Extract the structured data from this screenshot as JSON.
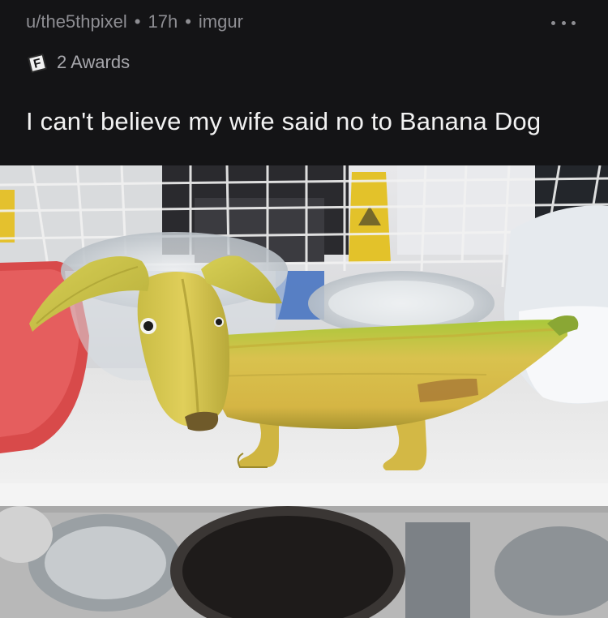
{
  "post": {
    "author": "u/the5thpixel",
    "age": "17h",
    "source": "imgur",
    "separator": "•",
    "awards_label": "2 Awards",
    "award_glyph": "F",
    "title": "I can't believe my wife said no to Banana Dog"
  },
  "icons": {
    "more": "more-options-icon",
    "award": "award-icon"
  },
  "colors": {
    "background": "#141416",
    "meta_text": "#8e8e93",
    "title_text": "#f2f2f2"
  }
}
